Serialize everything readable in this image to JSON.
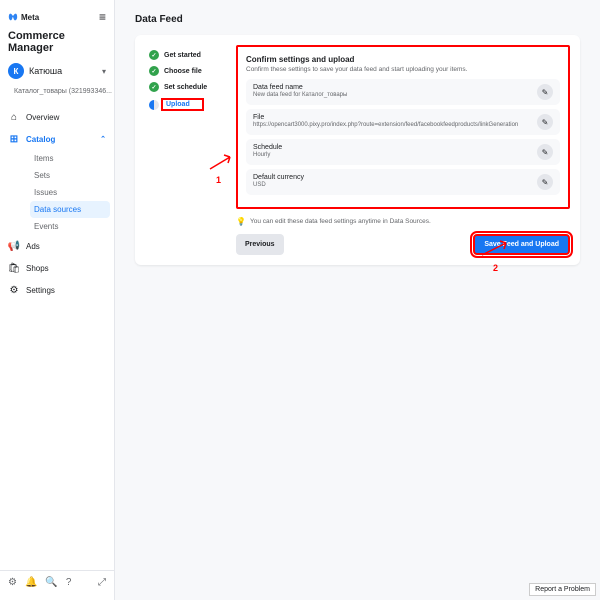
{
  "brand": "Meta",
  "app_title": "Commerce Manager",
  "account": {
    "initial": "К",
    "name": "Катюша"
  },
  "catalog_selector": "Каталог_товары (321993346...",
  "nav": {
    "overview": "Overview",
    "catalog": "Catalog",
    "ads": "Ads",
    "shops": "Shops",
    "settings": "Settings",
    "sub": {
      "items": "Items",
      "sets": "Sets",
      "issues": "Issues",
      "data_sources": "Data sources",
      "events": "Events"
    }
  },
  "page_title": "Data Feed",
  "steps": {
    "s1": "Get started",
    "s2": "Choose file",
    "s3": "Set schedule",
    "s4": "Upload"
  },
  "panel": {
    "title": "Confirm settings and upload",
    "desc": "Confirm these settings to save your data feed and start uploading your items.",
    "f1_label": "Data feed name",
    "f1_value": "New data feed for Каталог_товары",
    "f2_label": "File",
    "f2_value": "https://opencart3000.pixy.pro/index.php?route=extension/feed/facebookfeedproducts/linkGeneration",
    "f3_label": "Schedule",
    "f3_value": "Hourly",
    "f4_label": "Default currency",
    "f4_value": "USD",
    "hint": "You can edit these data feed settings anytime in Data Sources."
  },
  "buttons": {
    "prev": "Previous",
    "save": "Save Feed and Upload"
  },
  "annotations": {
    "n1": "1",
    "n2": "2"
  },
  "footer": {
    "report": "Report a Problem"
  }
}
